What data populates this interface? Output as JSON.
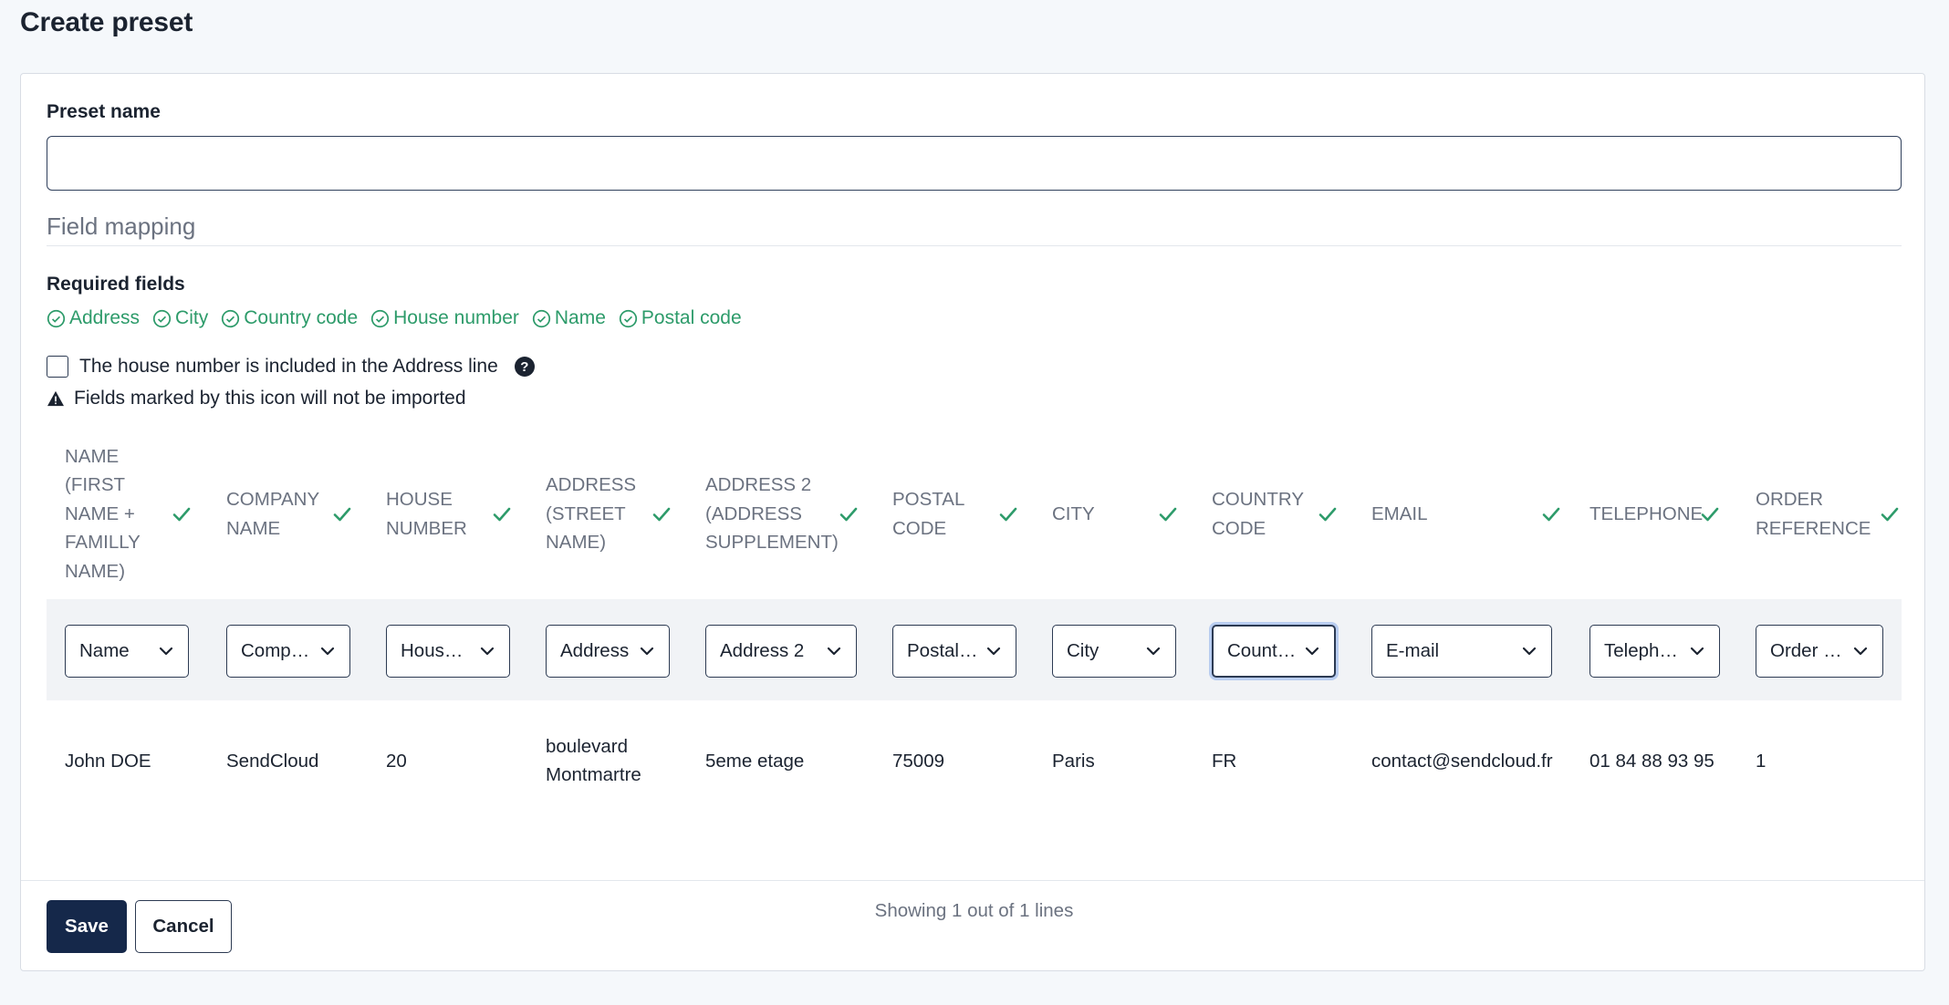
{
  "page": {
    "title": "Create preset"
  },
  "form": {
    "preset_name_label": "Preset name",
    "preset_name_value": "",
    "field_mapping_title": "Field mapping",
    "required_fields_title": "Required fields",
    "required_fields": [
      "Address",
      "City",
      "Country code",
      "House number",
      "Name",
      "Postal code"
    ],
    "house_number_checkbox_label": "The house number is included in the Address line",
    "house_number_checked": false,
    "warning_text": "Fields marked by this icon will not be imported"
  },
  "table": {
    "columns": [
      {
        "header": "NAME (FIRST NAME + FAMILLY NAME)",
        "mapped": true,
        "select": "Name",
        "value": "John DOE"
      },
      {
        "header": "COMPANY NAME",
        "mapped": true,
        "select": "Company name",
        "value": "SendCloud"
      },
      {
        "header": "HOUSE NUMBER",
        "mapped": true,
        "select": "House number",
        "value": "20"
      },
      {
        "header": "ADDRESS (STREET NAME)",
        "mapped": true,
        "select": "Address",
        "value": "boulevard Montmartre"
      },
      {
        "header": "ADDRESS 2 (ADDRESS SUPPLEMENT)",
        "mapped": true,
        "select": "Address 2",
        "value": "5eme etage"
      },
      {
        "header": "POSTAL CODE",
        "mapped": true,
        "select": "Postal code",
        "value": "75009"
      },
      {
        "header": "CITY",
        "mapped": true,
        "select": "City",
        "value": "Paris"
      },
      {
        "header": "COUNTRY CODE",
        "mapped": true,
        "select": "Country code",
        "value": "FR",
        "focused": true
      },
      {
        "header": "EMAIL",
        "mapped": true,
        "select": "E-mail",
        "value": "contact@sendcloud.fr"
      },
      {
        "header": "TELEPHONE",
        "mapped": true,
        "select": "Telephone",
        "value": "01 84 88 93 95"
      },
      {
        "header": "ORDER REFERENCE",
        "mapped": true,
        "select": "Order reference",
        "value": "1"
      }
    ],
    "showing_text": "Showing 1 out of 1 lines"
  },
  "footer": {
    "save_label": "Save",
    "cancel_label": "Cancel"
  },
  "colors": {
    "accent": "#15284a",
    "success": "#2d9b6a",
    "muted": "#6b7280",
    "focus_ring": "#b9cdf0"
  },
  "icons": {
    "required_ok": "check-circle-icon",
    "mapped": "check-icon",
    "help": "question-circle-icon",
    "warning": "warning-triangle-icon",
    "dropdown": "chevron-down-icon"
  }
}
